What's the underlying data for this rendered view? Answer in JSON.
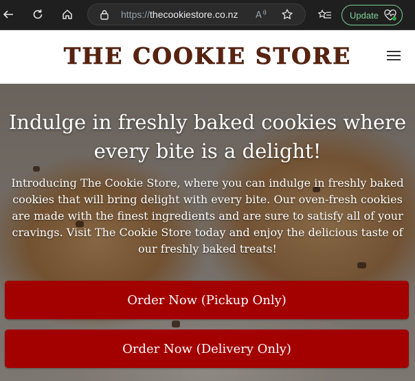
{
  "browser": {
    "url_prefix": "https://",
    "url_host": "thecookiestore.co.nz",
    "update_label": "Update"
  },
  "site": {
    "logo_text": "THE COOKIE STORE"
  },
  "hero": {
    "title": "Indulge in freshly baked cookies where every bite is a delight!",
    "body": "Introducing The Cookie Store, where you can indulge in freshly baked cookies that will bring delight with every bite. Our oven-fresh cookies are made with the finest ingredients and are sure to satisfy all of your cravings. Visit The Cookie Store today and enjoy the delicious taste of our freshly baked treats!",
    "buttons": [
      {
        "label": "Order Now (Pickup Only)"
      },
      {
        "label": "Order Now (Delivery Only)"
      }
    ]
  },
  "colors": {
    "brand_brown": "#5a2310",
    "button_red": "#a30000",
    "update_green": "#7ed39a"
  },
  "icons": [
    "back-icon",
    "reload-icon",
    "home-icon",
    "lock-icon",
    "read-aloud-icon",
    "favorite-star-icon",
    "collections-icon",
    "heart-pulse-icon",
    "hamburger-menu-icon"
  ]
}
